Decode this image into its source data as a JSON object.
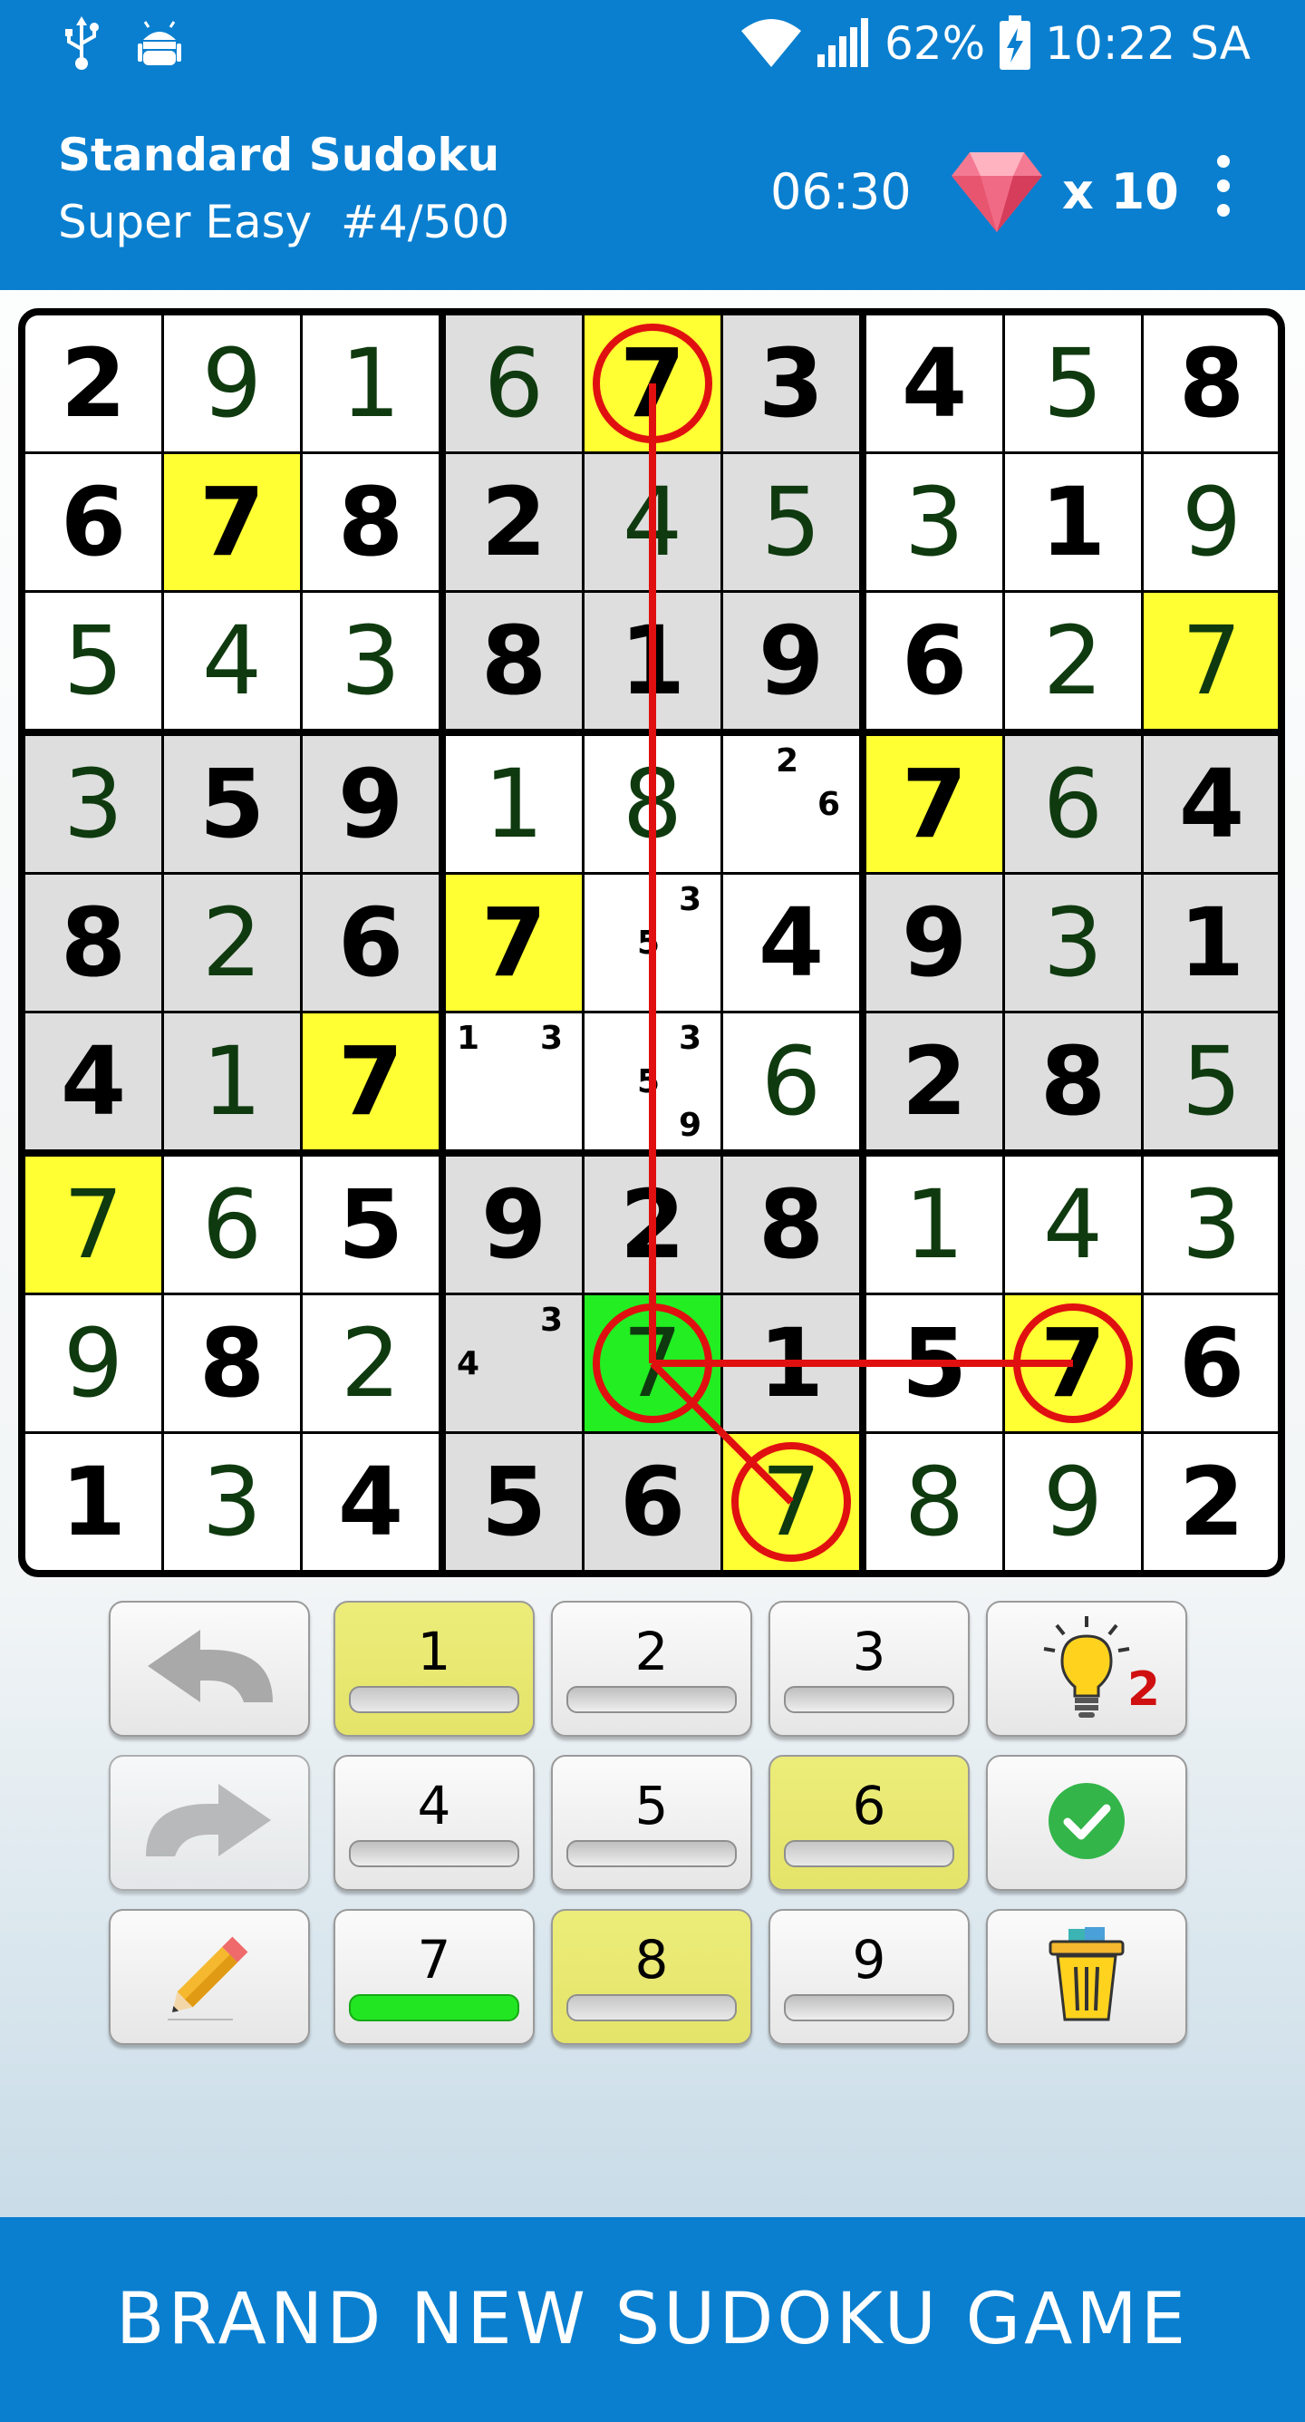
{
  "status_bar": {
    "icons": [
      "usb-icon",
      "android-debug-icon",
      "wifi-icon",
      "signal-icon",
      "battery-charging-icon"
    ],
    "battery": "62%",
    "time": "10:22 SA"
  },
  "header": {
    "title": "Standard Sudoku",
    "subtitle": "Super Easy  #4/500",
    "timer": "06:30",
    "gems": "x 10"
  },
  "board": {
    "rows": [
      [
        "2",
        "9",
        "1",
        "6",
        "7",
        "3",
        "4",
        "5",
        "8"
      ],
      [
        "6",
        "7",
        "8",
        "2",
        "4",
        "5",
        "3",
        "1",
        "9"
      ],
      [
        "5",
        "4",
        "3",
        "8",
        "1",
        "9",
        "6",
        "2",
        "7"
      ],
      [
        "3",
        "5",
        "9",
        "1",
        "8",
        "",
        "7",
        "6",
        "4"
      ],
      [
        "8",
        "2",
        "6",
        "7",
        "",
        "4",
        "9",
        "3",
        "1"
      ],
      [
        "4",
        "1",
        "7",
        "",
        "",
        "6",
        "2",
        "8",
        "5"
      ],
      [
        "7",
        "6",
        "5",
        "9",
        "2",
        "8",
        "1",
        "4",
        "3"
      ],
      [
        "9",
        "8",
        "2",
        "",
        "7",
        "1",
        "5",
        "7",
        "6"
      ],
      [
        "1",
        "3",
        "4",
        "5",
        "6",
        "7",
        "8",
        "9",
        "2"
      ]
    ],
    "given": [
      [
        1,
        0,
        0,
        0,
        1,
        1,
        1,
        0,
        1
      ],
      [
        1,
        1,
        1,
        1,
        0,
        0,
        0,
        1,
        0
      ],
      [
        0,
        0,
        0,
        1,
        1,
        1,
        1,
        0,
        0
      ],
      [
        0,
        1,
        1,
        0,
        0,
        0,
        1,
        0,
        1
      ],
      [
        1,
        0,
        1,
        1,
        0,
        1,
        1,
        0,
        1
      ],
      [
        1,
        0,
        1,
        0,
        0,
        0,
        1,
        1,
        0
      ],
      [
        0,
        0,
        1,
        1,
        1,
        1,
        0,
        0,
        0
      ],
      [
        0,
        1,
        0,
        0,
        0,
        1,
        1,
        1,
        1
      ],
      [
        1,
        0,
        1,
        1,
        1,
        0,
        0,
        0,
        1
      ]
    ],
    "shaded": [
      [
        0,
        0,
        0,
        1,
        1,
        1,
        0,
        0,
        0
      ],
      [
        0,
        0,
        0,
        1,
        1,
        1,
        0,
        0,
        0
      ],
      [
        0,
        0,
        0,
        1,
        1,
        1,
        0,
        0,
        0
      ],
      [
        1,
        1,
        1,
        0,
        0,
        0,
        1,
        1,
        1
      ],
      [
        1,
        1,
        1,
        0,
        0,
        0,
        1,
        1,
        1
      ],
      [
        1,
        1,
        1,
        0,
        0,
        0,
        1,
        1,
        1
      ],
      [
        0,
        0,
        0,
        1,
        1,
        1,
        0,
        0,
        0
      ],
      [
        0,
        0,
        0,
        1,
        1,
        1,
        0,
        0,
        0
      ],
      [
        0,
        0,
        0,
        1,
        1,
        1,
        0,
        0,
        0
      ]
    ],
    "highlighted_yellow": [
      [
        0,
        4
      ],
      [
        1,
        1
      ],
      [
        2,
        8
      ],
      [
        3,
        6
      ],
      [
        4,
        3
      ],
      [
        5,
        2
      ],
      [
        6,
        0
      ],
      [
        7,
        7
      ],
      [
        8,
        5
      ]
    ],
    "selected_green": [
      7,
      4
    ],
    "candidates": [
      {
        "row": 3,
        "col": 5,
        "marks": [
          "2",
          "6"
        ]
      },
      {
        "row": 4,
        "col": 4,
        "marks": [
          "3",
          "5"
        ]
      },
      {
        "row": 5,
        "col": 3,
        "marks": [
          "1",
          "3"
        ]
      },
      {
        "row": 5,
        "col": 4,
        "marks": [
          "3",
          "5",
          "9"
        ]
      },
      {
        "row": 7,
        "col": 3,
        "marks": [
          "3",
          "4"
        ]
      }
    ],
    "conflict_circles": [
      [
        0,
        4
      ],
      [
        7,
        4
      ],
      [
        7,
        7
      ],
      [
        8,
        5
      ]
    ],
    "highlight_colors": {
      "yellow": "#ffff33",
      "green": "#22ee22",
      "shade": "#dedede",
      "circle": "#e01010"
    }
  },
  "keypad": {
    "numbers": [
      "1",
      "2",
      "3",
      "4",
      "5",
      "6",
      "7",
      "8",
      "9"
    ],
    "yellow_keys": [
      "1",
      "6",
      "8"
    ],
    "green_key": "7",
    "hint_count": "2",
    "tool_icons": [
      "undo-icon",
      "redo-icon",
      "pencil-icon",
      "hint-bulb-icon",
      "check-icon",
      "trash-icon"
    ]
  },
  "footer": {
    "text": "BRAND NEW SUDOKU GAME"
  }
}
